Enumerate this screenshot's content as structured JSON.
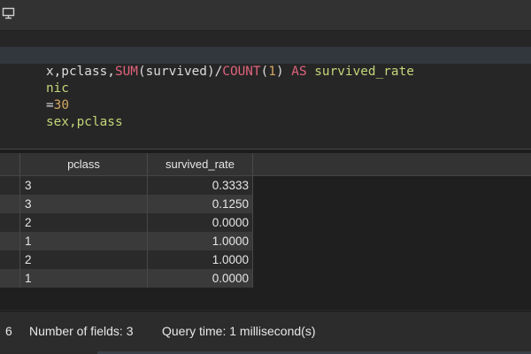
{
  "editor": {
    "lines": [
      [
        {
          "t": "x,pclass,",
          "c": "white"
        },
        {
          "t": "SUM",
          "c": "func"
        },
        {
          "t": "(survived)/",
          "c": "white"
        },
        {
          "t": "COUNT",
          "c": "func"
        },
        {
          "t": "(",
          "c": "white"
        },
        {
          "t": "1",
          "c": "num"
        },
        {
          "t": ") ",
          "c": "white"
        },
        {
          "t": "AS",
          "c": "kw"
        },
        {
          "t": " survived_rate",
          "c": "green"
        }
      ],
      [
        {
          "t": "nic",
          "c": "green"
        }
      ],
      [
        {
          "t": "=",
          "c": "white"
        },
        {
          "t": "30",
          "c": "num"
        }
      ],
      [
        {
          "t": "sex,pclass",
          "c": "green"
        }
      ]
    ]
  },
  "results": {
    "columns": [
      "pclass",
      "survived_rate"
    ],
    "rows": [
      [
        "3",
        "0.3333"
      ],
      [
        "3",
        "0.1250"
      ],
      [
        "2",
        "0.0000"
      ],
      [
        "1",
        "1.0000"
      ],
      [
        "2",
        "1.0000"
      ],
      [
        "1",
        "0.0000"
      ]
    ]
  },
  "status": {
    "rows_count": "6",
    "fields": "Number of fields: 3",
    "query_time": "Query time: 1 millisecond(s)"
  },
  "icons": {
    "toolbar": "monitor-icon"
  },
  "colors": {
    "keyword": "#e0637c",
    "number": "#d4a862",
    "identifier": "#c3d67a",
    "current_line": "#32373e"
  }
}
